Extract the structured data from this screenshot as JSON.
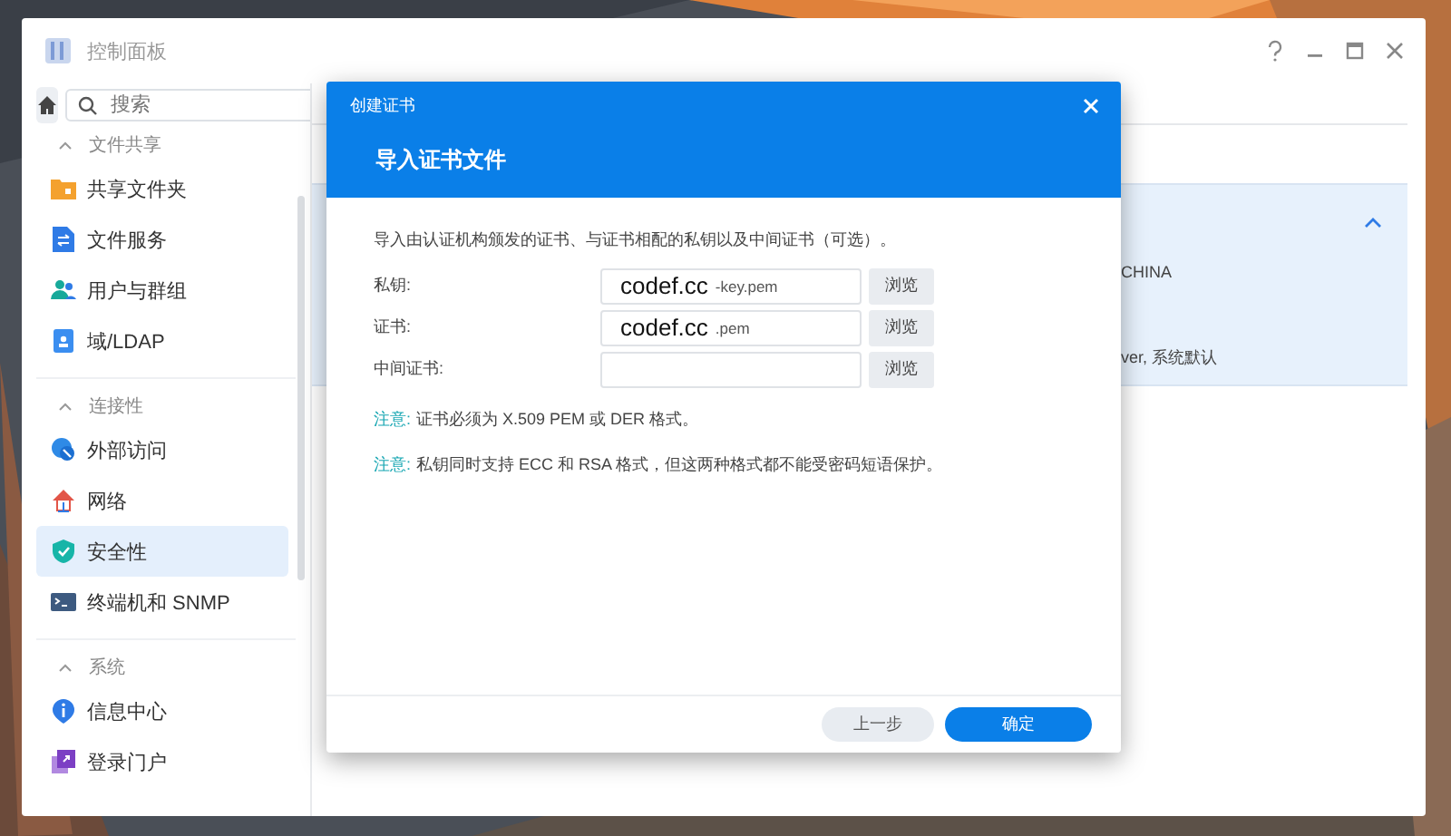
{
  "window": {
    "title": "控制面板"
  },
  "sidebar": {
    "search": {
      "placeholder": "搜索"
    },
    "sections": [
      {
        "title": "文件共享",
        "expanded": true,
        "items": [
          {
            "label": "共享文件夹",
            "selected": false
          },
          {
            "label": "文件服务",
            "selected": false
          },
          {
            "label": "用户与群组",
            "selected": false
          },
          {
            "label": "域/LDAP",
            "selected": false
          }
        ]
      },
      {
        "title": "连接性",
        "expanded": true,
        "items": [
          {
            "label": "外部访问",
            "selected": false
          },
          {
            "label": "网络",
            "selected": false
          },
          {
            "label": "安全性",
            "selected": true
          },
          {
            "label": "终端机和 SNMP",
            "selected": false
          }
        ]
      },
      {
        "title": "系统",
        "expanded": true,
        "items": [
          {
            "label": "信息中心",
            "selected": false
          },
          {
            "label": "登录门户",
            "selected": false
          }
        ]
      }
    ]
  },
  "background_panel": {
    "expanded": true,
    "line_1": "CHINA",
    "line_2": "ver, 系统默认"
  },
  "dialog": {
    "title": "创建证书",
    "heading": "导入证书文件",
    "description": "导入由认证机构颁发的证书、与证书相配的私钥以及中间证书（可选）。",
    "fields": [
      {
        "label": "私钥:",
        "value_main": "codef.cc",
        "value_suffix": "-key.pem",
        "button": "浏览"
      },
      {
        "label": "证书:",
        "value_main": "codef.cc",
        "value_suffix": ".pem",
        "button": "浏览"
      },
      {
        "label": "中间证书:",
        "button": "浏览"
      }
    ],
    "notes": [
      {
        "label": "注意:",
        "text": "证书必须为 X.509 PEM 或 DER 格式。"
      },
      {
        "label": "注意:",
        "text": "私钥同时支持 ECC 和 RSA 格式，但这两种格式都不能受密码短语保护。"
      }
    ],
    "buttons": [
      {
        "label": "上一步",
        "kind": "secondary"
      },
      {
        "label": "确定",
        "kind": "primary"
      }
    ]
  }
}
